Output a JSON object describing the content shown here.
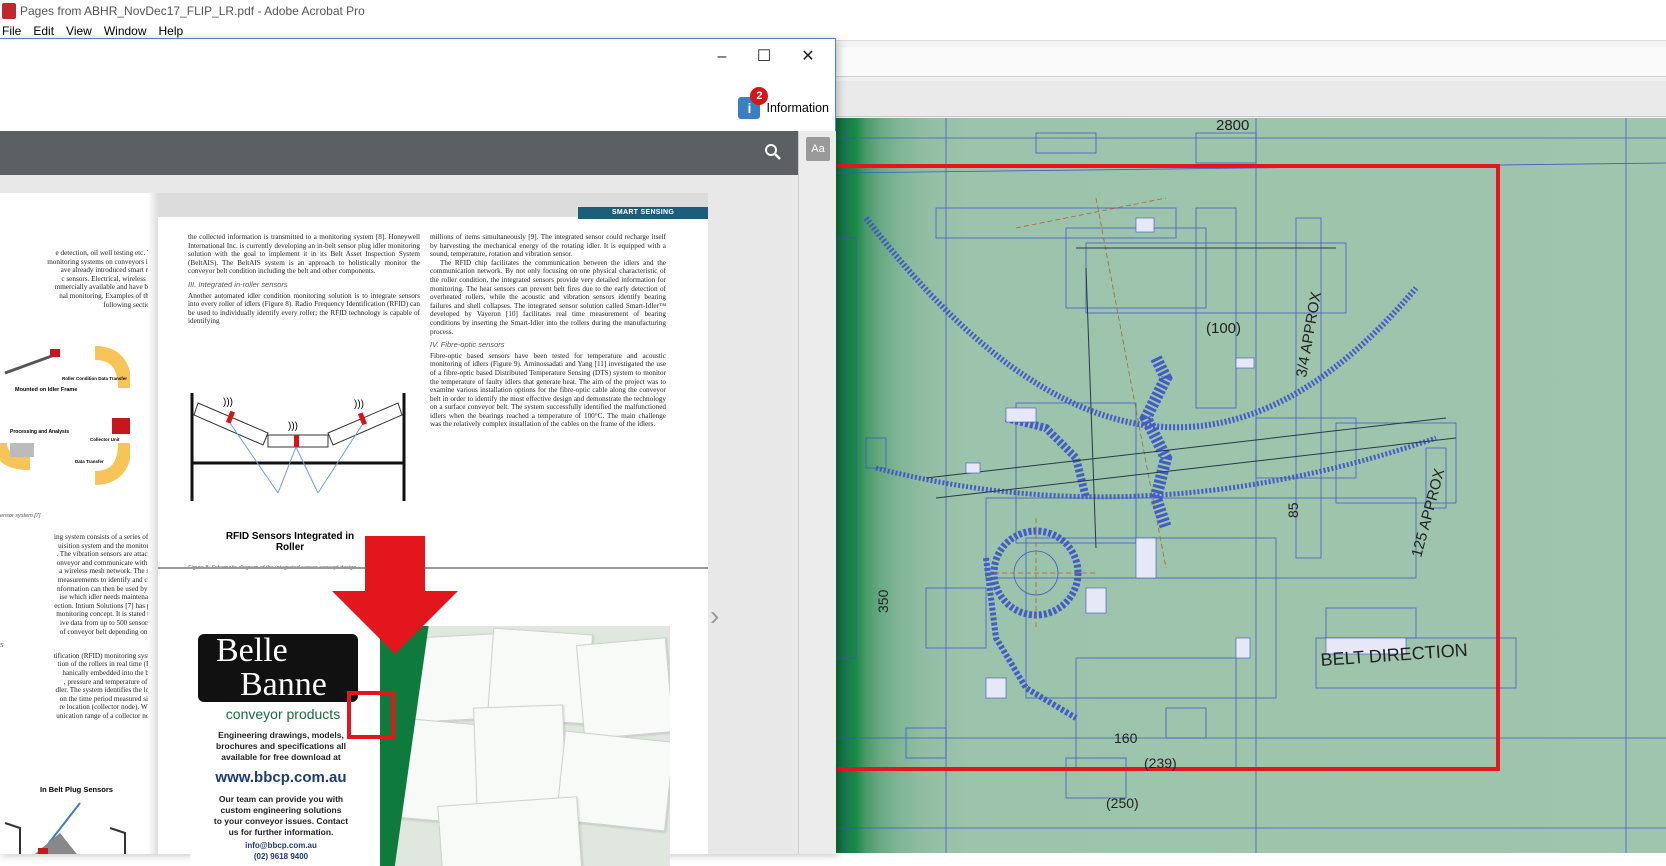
{
  "app": {
    "title": "Pages from ABHR_NovDec17_FLIP_LR.pdf - Adobe Acrobat Pro",
    "menu": [
      "File",
      "Edit",
      "View",
      "Window",
      "Help"
    ]
  },
  "popup": {
    "info_label": "Information",
    "info_badge": "2",
    "aa_label": "Aa",
    "min_icon": "minimize-icon",
    "max_icon": "maximize-icon",
    "close_icon": "close-icon"
  },
  "page": {
    "section_tag": "SMART SENSING",
    "left_col": [
      "e detection, oil well testing etc. The",
      "monitoring systems on conveyors is in",
      "ave already introduced smart roll-",
      "c sensors. Electrical, wireless and",
      "mmercially available and have been",
      "nal monitoring. Examples of these",
      "following sections."
    ],
    "left_figure_labels": [
      "Mounted on Idler Frame",
      "Roller Condition Data Transfer",
      "Collector Unit",
      "Processing and Analysis",
      "Data Transfer"
    ],
    "left_caption": "ensor system [7].",
    "left_col2": [
      "ing system consists of a series of vi-",
      "uisition system and the monitoring",
      ". The vibration sensors are attached",
      "onveyor and communicate with the",
      "a wireless mesh network. The sys-",
      "measurements to identify and clas-",
      "nformation can then be used by the",
      "ise which idler needs maintenance",
      "ection. Intium Solutions [7] has pat-",
      "monitoring concept. It is stated that",
      "ive data from up to 500 sensors or",
      " of conveyor belt depending on the"
    ],
    "left_hdr2": "s",
    "left_col3": [
      "tification (RFID) monitoring system",
      "tion of the rollers in real time (Fig-",
      "hanically embedded into the belt.",
      ", pressure and temperature of the",
      "dler. The system identifies the loca-",
      "on the time period measured since",
      "re location (collector node). When",
      "unication range of a collector node,"
    ],
    "left_fig2": "In Belt Plug Sensors",
    "mid_col": "the collected information is transmitted to a monitoring system [8]. Honeywell International Inc. is currently developing an in-belt sensor plug idler monitoring solution with the goal to implement it in its Belt Asset Inspection System (BeltAIS). The BeltAIS system is an approach to holistically monitor the conveyor belt condition including the belt and other components.",
    "mid_hdr": "III. Integrated in-roller sensors",
    "mid_col2": "Another automated idler condition monitoring solution is to integrate sensors into every roller of idlers (Figure 8). Radio Frequency Identification (RFID) can be used to individually identify every roller; the RFID technology is capable of identifying",
    "fig_label": "RFID Sensors Integrated in Roller",
    "fig_caption": "Figure 8: Schematic diagram of the integrated sensor concept design.",
    "right_col": "millions of items simultaneously [9]. The integrated sensor could recharge itself by harvesting the mechanical energy of the rotating idler. It is equipped with a sound, temperature, rotation and vibration sensor.",
    "right_col2": "The RFID chip facilitates the communication between the idlers and the communication network. By not only focusing on one physical characteristic of the roller condition, the integrated sensors provide very detailed information for monitoring. The heat sensors can prevent belt fires due to the early detection of overheated rollers, while the acoustic and vibration sensors identify bearing failures and shell collapses. The integrated sensor solution called Smart-Idler™ developed by Vayeron [10] facilitates real time measurement of bearing conditions by inserting the Smart-Idler into the rollers during the manufacturing process.",
    "right_hdr": "IV. Fibre-optic sensors",
    "right_col3": "Fibre-optic based sensors have been tested for temperature and acoustic monitoring of idlers (Figure 9). Aminossadati and Yang [11] investigated the use of a fibre-optic based Distributed Temperature Sensing (DTS) system to monitor the temperature of faulty idlers that generate heat. The aim of the project was to examine various installation options for the fibre-optic cable along the conveyor belt in order to identify the most effective design and demonstrate the technology on a surface conveyor belt. The system successfully identified the malfunctioned idlers when the bearings reached a temperature of 100°C. The main challenge was the relatively complex installation of the cables on the frame of the idlers."
  },
  "ad": {
    "logo_top": "Belle",
    "logo_bottom": "Banne",
    "subtitle": "conveyor products",
    "line1": "Engineering drawings, models,",
    "line2": "brochures and specifications all",
    "line3": "available for free download at",
    "url": "www.bbcp.com.au",
    "line4": "Our team can provide you with",
    "line5": "custom engineering solutions",
    "line6": "to your conveyor issues. Contact",
    "line7": "us for further information.",
    "email": "info@bbcp.com.au",
    "phone": "(02) 9618 9400"
  },
  "drawing": {
    "labels": [
      "2800",
      "(100)",
      "3/4 APPROX",
      "125 APPROX",
      "85",
      "350",
      "BELT DIRECTION",
      "160",
      "(239)",
      "(250)"
    ]
  },
  "colors": {
    "highlight_red": "#e3161d",
    "drawing_bg": "#a0c5ae",
    "box_blue": "#3a52c8"
  }
}
